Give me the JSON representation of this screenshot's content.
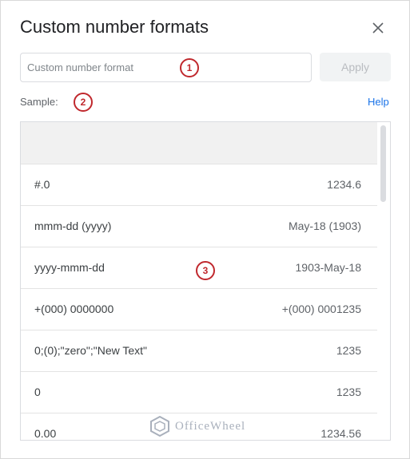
{
  "dialog": {
    "title": "Custom number formats",
    "close_icon": "close-icon"
  },
  "input": {
    "placeholder": "Custom number format",
    "value": ""
  },
  "apply_label": "Apply",
  "sample_label": "Sample:",
  "help_label": "Help",
  "markers": [
    "1",
    "2",
    "3"
  ],
  "formats": [
    {
      "format": "#.0",
      "sample": "1234.6"
    },
    {
      "format": "mmm-dd (yyyy)",
      "sample": "May-18 (1903)"
    },
    {
      "format": "yyyy-mmm-dd",
      "sample": "1903-May-18"
    },
    {
      "format": "+(000) 0000000",
      "sample": "+(000) 0001235"
    },
    {
      "format": "0;(0);\"zero\";\"New Text\"",
      "sample": "1235"
    },
    {
      "format": "0",
      "sample": "1235"
    },
    {
      "format": "0.00",
      "sample": "1234.56"
    }
  ],
  "watermark": "OfficeWheel",
  "colors": {
    "accent": "#1a73e8",
    "marker": "#c0282d"
  }
}
